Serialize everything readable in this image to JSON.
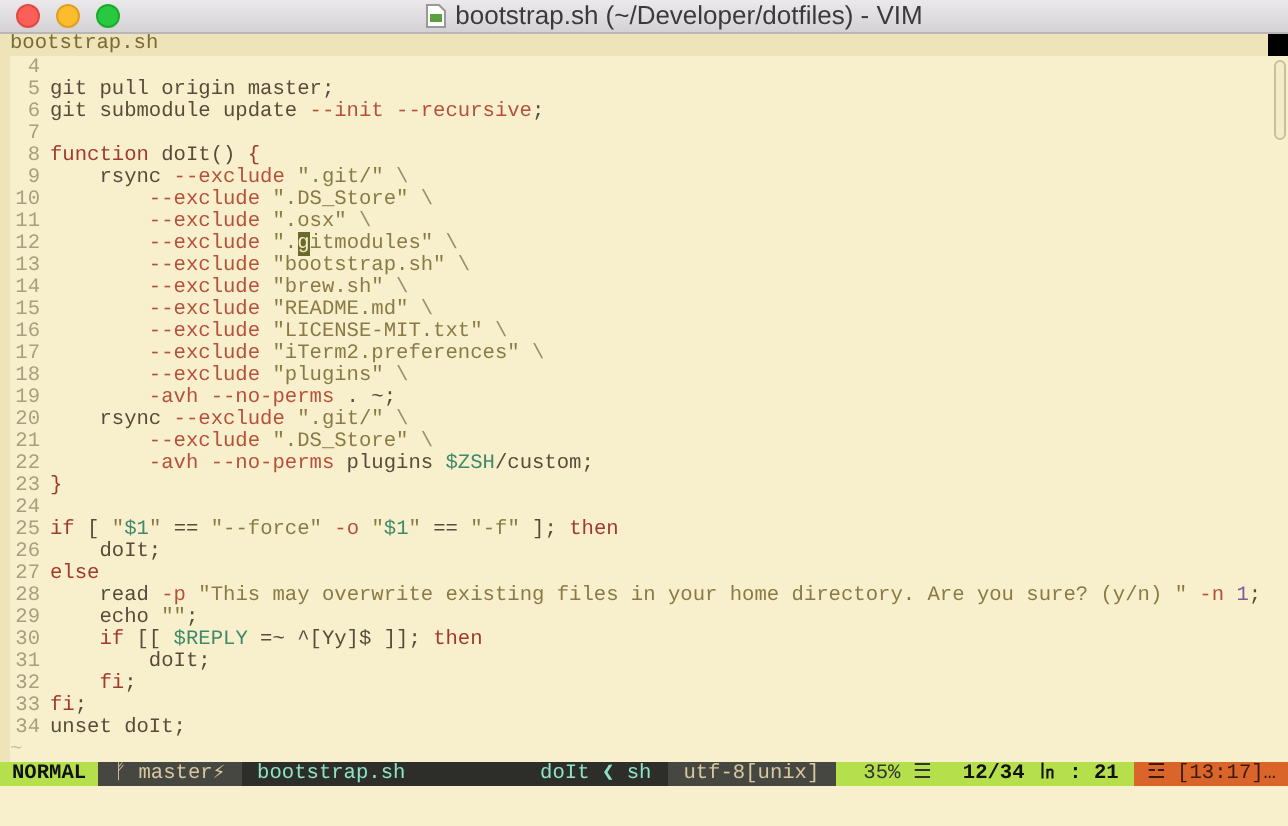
{
  "window": {
    "title": "bootstrap.sh (~/Developer/dotfiles) - VIM"
  },
  "tab": {
    "label": "bootstrap.sh"
  },
  "lines": [
    {
      "number": "4"
    },
    {
      "number": "5",
      "tokens": [
        {
          "kind": "plain",
          "text": "git pull origin master;"
        }
      ]
    },
    {
      "number": "6",
      "tokens": [
        {
          "kind": "plain",
          "text": "git submodule update "
        },
        {
          "kind": "flag",
          "text": "--init --recursive"
        },
        {
          "kind": "plain",
          "text": ";"
        }
      ]
    },
    {
      "number": "7"
    },
    {
      "number": "8",
      "tokens": [
        {
          "kind": "keyword",
          "text": "function"
        },
        {
          "kind": "plain",
          "text": " doIt() "
        },
        {
          "kind": "keyword",
          "text": "{"
        }
      ]
    },
    {
      "number": "9",
      "tokens": [
        {
          "kind": "plain",
          "text": "    rsync "
        },
        {
          "kind": "flag",
          "text": "--exclude"
        },
        {
          "kind": "string",
          "text": " \".git/\""
        },
        {
          "kind": "muted",
          "text": " \\"
        }
      ]
    },
    {
      "number": "10",
      "tokens": [
        {
          "kind": "flag",
          "text": "        --exclude"
        },
        {
          "kind": "string",
          "text": " \".DS_Store\""
        },
        {
          "kind": "muted",
          "text": " \\"
        }
      ]
    },
    {
      "number": "11",
      "tokens": [
        {
          "kind": "flag",
          "text": "        --exclude"
        },
        {
          "kind": "string",
          "text": " \".osx\""
        },
        {
          "kind": "muted",
          "text": " \\"
        }
      ]
    },
    {
      "number": "12",
      "tokens": [
        {
          "kind": "flag",
          "text": "        --exclude"
        },
        {
          "kind": "string",
          "text": " \"."
        },
        {
          "kind": "cursor",
          "text": "g"
        },
        {
          "kind": "string",
          "text": "itmodules\""
        },
        {
          "kind": "muted",
          "text": " \\"
        }
      ]
    },
    {
      "number": "13",
      "tokens": [
        {
          "kind": "flag",
          "text": "        --exclude"
        },
        {
          "kind": "string",
          "text": " \"bootstrap.sh\""
        },
        {
          "kind": "muted",
          "text": " \\"
        }
      ]
    },
    {
      "number": "14",
      "tokens": [
        {
          "kind": "flag",
          "text": "        --exclude"
        },
        {
          "kind": "string",
          "text": " \"brew.sh\""
        },
        {
          "kind": "muted",
          "text": " \\"
        }
      ]
    },
    {
      "number": "15",
      "tokens": [
        {
          "kind": "flag",
          "text": "        --exclude"
        },
        {
          "kind": "string",
          "text": " \"README.md\""
        },
        {
          "kind": "muted",
          "text": " \\"
        }
      ]
    },
    {
      "number": "16",
      "tokens": [
        {
          "kind": "flag",
          "text": "        --exclude"
        },
        {
          "kind": "string",
          "text": " \"LICENSE-MIT.txt\""
        },
        {
          "kind": "muted",
          "text": " \\"
        }
      ]
    },
    {
      "number": "17",
      "tokens": [
        {
          "kind": "flag",
          "text": "        --exclude"
        },
        {
          "kind": "string",
          "text": " \"iTerm2.preferences\""
        },
        {
          "kind": "muted",
          "text": " \\"
        }
      ]
    },
    {
      "number": "18",
      "tokens": [
        {
          "kind": "flag",
          "text": "        --exclude"
        },
        {
          "kind": "string",
          "text": " \"plugins\""
        },
        {
          "kind": "muted",
          "text": " \\"
        }
      ]
    },
    {
      "number": "19",
      "tokens": [
        {
          "kind": "flag",
          "text": "        -avh --no-perms"
        },
        {
          "kind": "plain",
          "text": " . ~;"
        }
      ]
    },
    {
      "number": "20",
      "tokens": [
        {
          "kind": "plain",
          "text": "    rsync "
        },
        {
          "kind": "flag",
          "text": "--exclude"
        },
        {
          "kind": "string",
          "text": " \".git/\""
        },
        {
          "kind": "muted",
          "text": " \\"
        }
      ]
    },
    {
      "number": "21",
      "tokens": [
        {
          "kind": "flag",
          "text": "        --exclude"
        },
        {
          "kind": "string",
          "text": " \".DS_Store\""
        },
        {
          "kind": "muted",
          "text": " \\"
        }
      ]
    },
    {
      "number": "22",
      "tokens": [
        {
          "kind": "flag",
          "text": "        -avh --no-perms"
        },
        {
          "kind": "plain",
          "text": " plugins "
        },
        {
          "kind": "variable",
          "text": "$ZSH"
        },
        {
          "kind": "plain",
          "text": "/custom;"
        }
      ]
    },
    {
      "number": "23",
      "tokens": [
        {
          "kind": "keyword",
          "text": "}"
        }
      ]
    },
    {
      "number": "24"
    },
    {
      "number": "25",
      "tokens": [
        {
          "kind": "keyword",
          "text": "if"
        },
        {
          "kind": "plain",
          "text": " [ "
        },
        {
          "kind": "string",
          "text": "\""
        },
        {
          "kind": "variable",
          "text": "$1"
        },
        {
          "kind": "string",
          "text": "\""
        },
        {
          "kind": "plain",
          "text": " == "
        },
        {
          "kind": "string",
          "text": "\"--force\""
        },
        {
          "kind": "flag",
          "text": " -o "
        },
        {
          "kind": "string",
          "text": "\""
        },
        {
          "kind": "variable",
          "text": "$1"
        },
        {
          "kind": "string",
          "text": "\""
        },
        {
          "kind": "plain",
          "text": " == "
        },
        {
          "kind": "string",
          "text": "\"-f\""
        },
        {
          "kind": "plain",
          "text": " ]; "
        },
        {
          "kind": "keyword",
          "text": "then"
        }
      ]
    },
    {
      "number": "26",
      "tokens": [
        {
          "kind": "plain",
          "text": "    doIt;"
        }
      ]
    },
    {
      "number": "27",
      "tokens": [
        {
          "kind": "keyword",
          "text": "else"
        }
      ]
    },
    {
      "number": "28",
      "tokens": [
        {
          "kind": "plain",
          "text": "    read "
        },
        {
          "kind": "flag",
          "text": "-p"
        },
        {
          "kind": "string",
          "text": " \"This may overwrite existing files in your home directory. Are you sure? (y/n) \""
        },
        {
          "kind": "flag",
          "text": " -n"
        },
        {
          "kind": "number",
          "text": " 1"
        },
        {
          "kind": "plain",
          "text": ";"
        }
      ]
    },
    {
      "number": "29",
      "tokens": [
        {
          "kind": "plain",
          "text": "    echo "
        },
        {
          "kind": "string",
          "text": "\"\""
        },
        {
          "kind": "plain",
          "text": ";"
        }
      ]
    },
    {
      "number": "30",
      "tokens": [
        {
          "kind": "keyword",
          "text": "    if"
        },
        {
          "kind": "plain",
          "text": " [[ "
        },
        {
          "kind": "variable",
          "text": "$REPLY"
        },
        {
          "kind": "plain",
          "text": " =~ ^[Yy]$ ]]; "
        },
        {
          "kind": "keyword",
          "text": "then"
        }
      ]
    },
    {
      "number": "31",
      "tokens": [
        {
          "kind": "plain",
          "text": "        doIt;"
        }
      ]
    },
    {
      "number": "32",
      "tokens": [
        {
          "kind": "keyword",
          "text": "    fi"
        },
        {
          "kind": "plain",
          "text": ";"
        }
      ]
    },
    {
      "number": "33",
      "tokens": [
        {
          "kind": "keyword",
          "text": "fi"
        },
        {
          "kind": "plain",
          "text": ";"
        }
      ]
    },
    {
      "number": "34",
      "tokens": [
        {
          "kind": "plain",
          "text": "unset doIt;"
        }
      ]
    }
  ],
  "end_of_buffer": "~",
  "status_line": {
    "mode": "NORMAL",
    "branch": "ᚠ master⚡",
    "file": "bootstrap.sh",
    "function": "doIt ❮ sh",
    "encoding": "utf-8[unix]",
    "percent": "35% ☰",
    "position": "12/34 ㏑ : 21",
    "clock": "☲ [13:17]…"
  }
}
